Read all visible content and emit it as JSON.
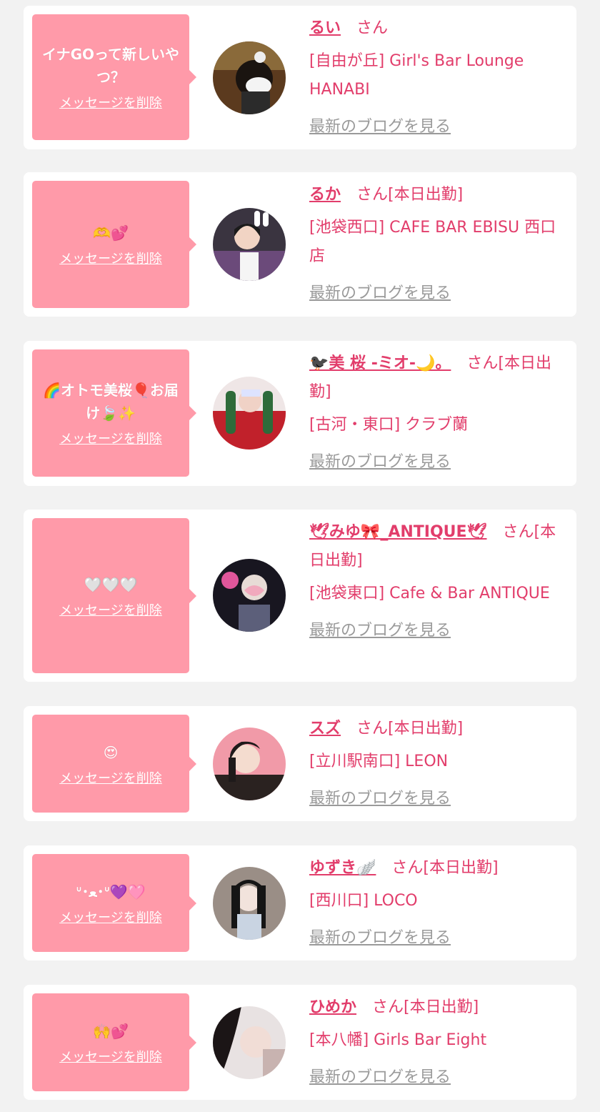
{
  "colors": {
    "page_background": "#f2f2f2",
    "card_background": "#ffffff",
    "bubble_pink": "#ff9aa9",
    "accent_pink": "#e23d6b",
    "link_gray": "#9a9a9a"
  },
  "messages": [
    {
      "bubble_text": "イナGOって新しいやつ？",
      "delete_label": "メッセージを削除",
      "name": "るい",
      "suffix": "さん",
      "shop": "[自由が丘] Girl's Bar Lounge HANABI",
      "blog_link": "最新のブログを見る"
    },
    {
      "bubble_text": "🫶💕",
      "delete_label": "メッセージを削除",
      "name": "るか",
      "suffix": "さん[本日出勤]",
      "shop": "[池袋西口] CAFE BAR EBISU 西口店",
      "blog_link": "最新のブログを見る"
    },
    {
      "bubble_text": "🌈オトモ美桜🎈お届け🍃✨",
      "delete_label": "メッセージを削除",
      "name": "🐦‍⬛美 桜 -ミオ-🌙。",
      "suffix": "さん[本日出勤]",
      "shop": "[古河・東口] クラブ蘭",
      "blog_link": "最新のブログを見る"
    },
    {
      "bubble_text": "🤍🤍🤍",
      "delete_label": "メッセージを削除",
      "name": "🕊みゆ🎀_ANTIQUE🕊",
      "suffix": "さん[本日出勤]",
      "shop": "[池袋東口] Cafe & Bar ANTIQUE",
      "blog_link": "最新のブログを見る"
    },
    {
      "bubble_text": "😍",
      "delete_label": "メッセージを削除",
      "name": "スズ",
      "suffix": "さん[本日出勤]",
      "shop": "[立川駅南口] LEON",
      "blog_link": "最新のブログを見る"
    },
    {
      "bubble_text": "ᐡ･ﻌ･ᐡ💜🩷",
      "delete_label": "メッセージを削除",
      "name": "ゆずき🪽",
      "suffix": "さん[本日出勤]",
      "shop": "[西川口] LOCO",
      "blog_link": "最新のブログを見る"
    },
    {
      "bubble_text": "🙌💕",
      "delete_label": "メッセージを削除",
      "name": "ひめか",
      "suffix": "さん[本日出勤]",
      "shop": "[本八幡] Girls Bar Eight",
      "blog_link": "最新のブログを見る"
    }
  ]
}
